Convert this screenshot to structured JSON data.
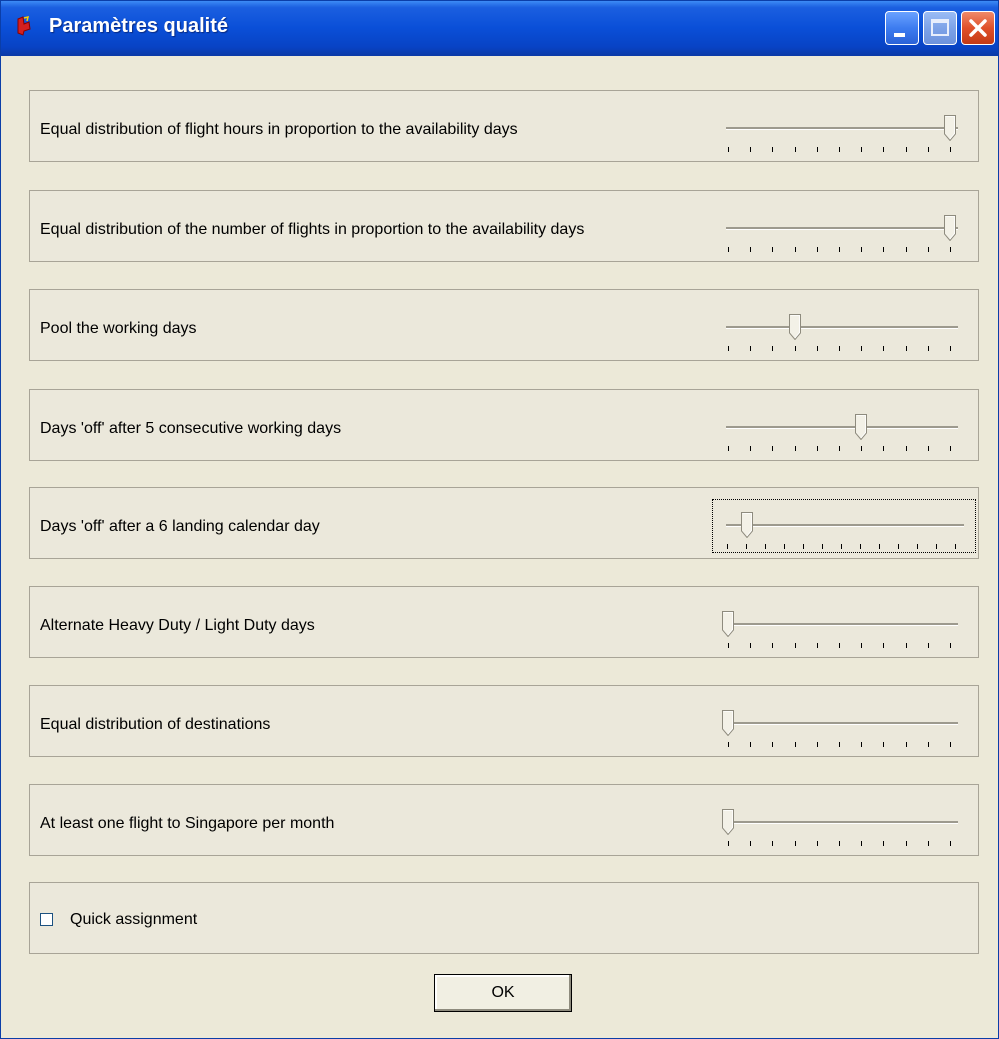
{
  "window": {
    "title": "Paramètres qualité",
    "colors": {
      "titlebar": "#0a4fd8",
      "close": "#e0502a",
      "face": "#ece9d8"
    }
  },
  "settings": [
    {
      "label": "Equal distribution of flight hours in proportion to the availability days",
      "value": 10,
      "max": 10,
      "focused": false
    },
    {
      "label": "Equal distribution of the number of flights in proportion to the availability days",
      "value": 10,
      "max": 10,
      "focused": false
    },
    {
      "label": "Pool the working days",
      "value": 3,
      "max": 10,
      "focused": false
    },
    {
      "label": "Days 'off' after 5 consecutive working days",
      "value": 6,
      "max": 10,
      "focused": false
    },
    {
      "label": "Days 'off' after a 6 landing calendar day",
      "value": 1,
      "max": 12,
      "focused": true
    },
    {
      "label": "Alternate Heavy Duty / Light Duty days",
      "value": 0,
      "max": 10,
      "focused": false
    },
    {
      "label": "Equal distribution of destinations",
      "value": 0,
      "max": 10,
      "focused": false
    },
    {
      "label": "At least one flight to Singapore per month",
      "value": 0,
      "max": 10,
      "focused": false
    }
  ],
  "quick_assignment": {
    "label": "Quick assignment",
    "checked": false
  },
  "ok_label": "OK",
  "icons": {
    "app": "app-icon",
    "minimize": "minimize-icon",
    "maximize": "maximize-icon",
    "close": "close-icon"
  }
}
